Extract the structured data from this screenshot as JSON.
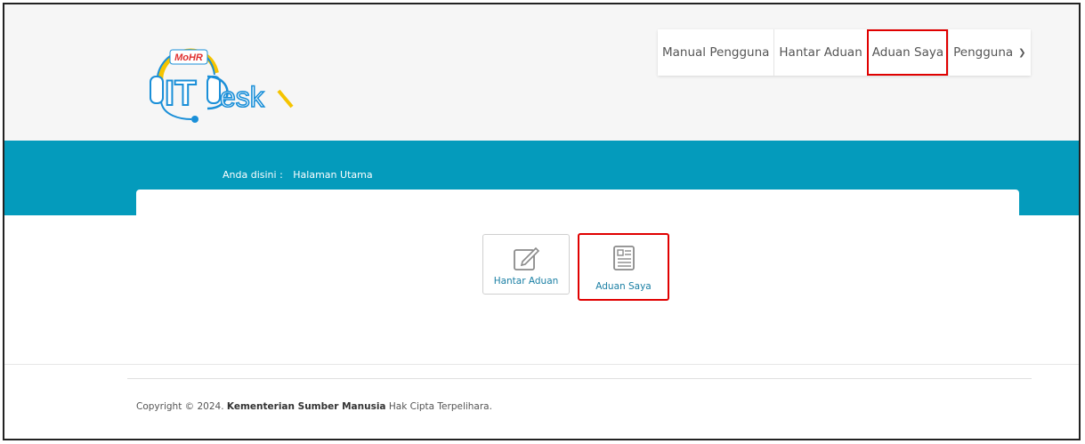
{
  "header": {
    "logo": {
      "badge_text": "MoHR",
      "wordmark_left": "IT",
      "wordmark_right": "esk"
    },
    "nav": [
      {
        "label": "Manual Pengguna"
      },
      {
        "label": "Hantar Aduan"
      },
      {
        "label": "Aduan Saya"
      },
      {
        "label": "Pengguna"
      }
    ]
  },
  "breadcrumb": {
    "prefix": "Anda disini :",
    "current": "Halaman Utama"
  },
  "tiles": [
    {
      "label": "Hantar Aduan",
      "icon": "edit-icon"
    },
    {
      "label": "Aduan Saya",
      "icon": "list-document-icon"
    }
  ],
  "footer": {
    "prefix": "Copyright © 2024.",
    "org": "Kementerian Sumber Manusia",
    "suffix": "Hak Cipta Terpelihara."
  },
  "colors": {
    "band": "#049bbc",
    "highlight": "#e00000",
    "header_bg": "#f6f6f6",
    "link": "#1a7fa4",
    "logo_blue": "#1a8fd8",
    "logo_yellow": "#f5c400"
  }
}
